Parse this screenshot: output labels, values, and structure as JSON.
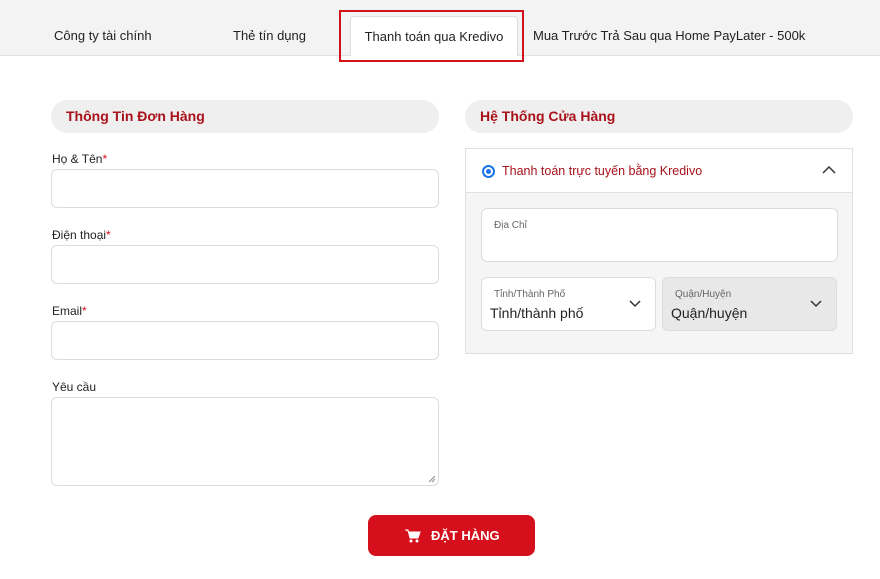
{
  "tabs": [
    {
      "label": "Công ty tài chính"
    },
    {
      "label": "Thẻ tín dụng"
    },
    {
      "label": "Thanh toán qua Kredivo"
    },
    {
      "label": "Mua Trước Trả Sau qua Home PayLater - 500k"
    }
  ],
  "order_info": {
    "title": "Thông Tin Đơn Hàng",
    "fields": [
      {
        "label": "Họ & Tên",
        "required": "*"
      },
      {
        "label": "Điện thoại",
        "required": "*"
      },
      {
        "label": "Email",
        "required": "*"
      },
      {
        "label": "Yêu cầu"
      }
    ]
  },
  "store_system": {
    "title": "Hệ Thống Cửa Hàng",
    "payment_option": "Thanh toán trực tuyến bằng Kredivo",
    "address_label": "Địa Chỉ",
    "city": {
      "label": "Tỉnh/Thành Phố",
      "value": "Tỉnh/thành phố"
    },
    "district": {
      "label": "Quận/Huyện",
      "value": "Quận/huyện"
    }
  },
  "submit_label": "ĐẶT HÀNG",
  "colors": {
    "brand_red": "#d50f1b",
    "title_red": "#a8111a",
    "radio_blue": "#1a73e8"
  },
  "icons": {
    "submit": "cart-icon",
    "panel_toggle": "chevron-up-icon",
    "select": "chevron-down-icon"
  }
}
